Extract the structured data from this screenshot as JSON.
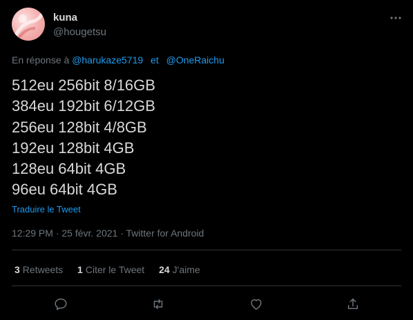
{
  "tweet": {
    "author_name": "kuna",
    "author_handle": "@hougetsu",
    "reply_prefix": "En réponse à",
    "reply_to": [
      "@harukaze5719",
      "@OneRaichu"
    ],
    "reply_separator": "et",
    "lines": [
      "512eu 256bit 8/16GB",
      "384eu 192bit 6/12GB",
      "256eu 128bit 4/8GB",
      "192eu 128bit 4GB",
      "128eu 64bit 4GB",
      "96eu 64bit 4GB"
    ],
    "translate_label": "Traduire le Tweet",
    "timestamp": "12:29 PM · 25 févr. 2021 · Twitter for Android"
  },
  "stats": {
    "retweets_count": "3",
    "retweets_label": "Retweets",
    "quotes_count": "1",
    "quotes_label": "Citer le Tweet",
    "likes_count": "24",
    "likes_label": "J'aime"
  },
  "icons": {
    "more": "more-horizontal-icon",
    "reply": "reply-icon",
    "retweet": "retweet-icon",
    "like": "heart-icon",
    "share": "share-icon"
  },
  "colors": {
    "background": "#000000",
    "text": "#d9d9d9",
    "muted": "#6e767d",
    "link": "#1d9bf0"
  }
}
